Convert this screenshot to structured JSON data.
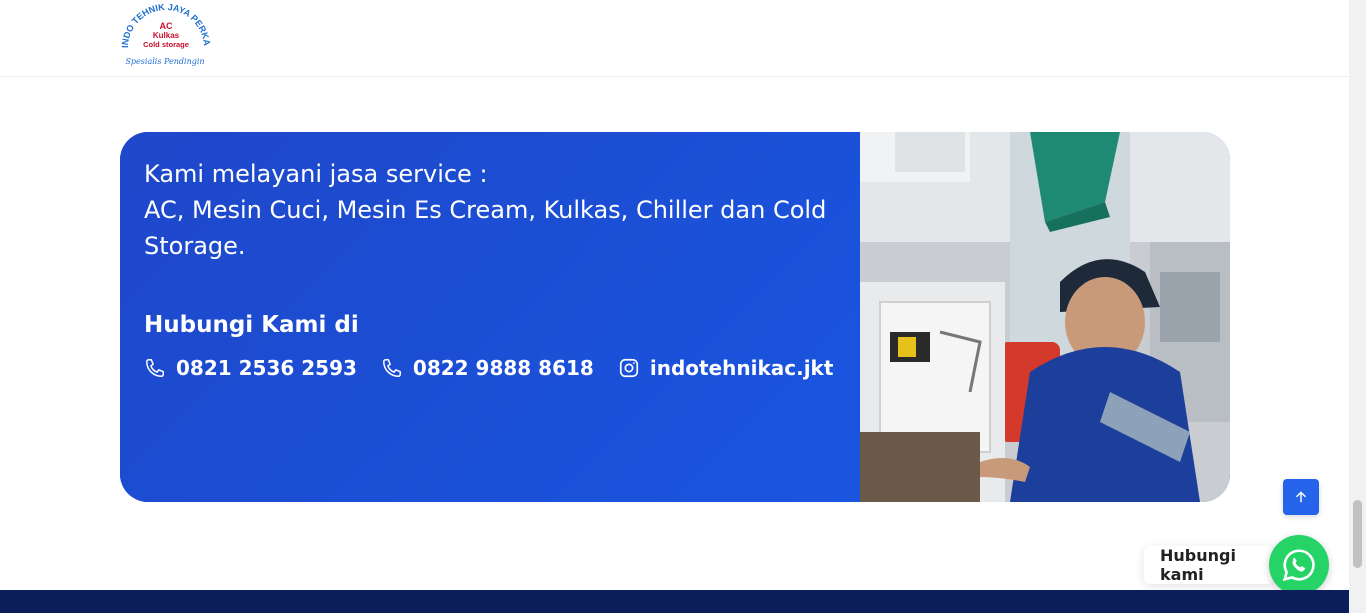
{
  "logo": {
    "arc_text": "INDO TEHNIK JAYA PERKASA",
    "line1": "AC",
    "line2": "Kulkas",
    "line3": "Cold storage",
    "tagline": "Spesialis Pendingin"
  },
  "services": {
    "line1": "Kami melayani jasa service :",
    "line2": "AC, Mesin Cuci, Mesin Es Cream, Kulkas, Chiller dan Cold",
    "line3": "Storage."
  },
  "contact": {
    "heading": "Hubungi Kami di",
    "items": [
      {
        "icon": "phone-icon",
        "text": "0821 2536 2593"
      },
      {
        "icon": "phone-icon",
        "text": "0822 9888 8618"
      },
      {
        "icon": "instagram-icon",
        "text": "indotehnikac.jkt"
      }
    ]
  },
  "photo": {
    "icon": "technician-photo"
  },
  "floating": {
    "back_to_top_icon": "arrow-up-icon",
    "whatsapp_label": "Hubungi kami",
    "whatsapp_icon": "whatsapp-icon"
  },
  "colors": {
    "card_blue": "#1b4fd6",
    "button_blue": "#2563eb",
    "whatsapp_green": "#25d366",
    "footer_navy": "#0c1d5c"
  }
}
